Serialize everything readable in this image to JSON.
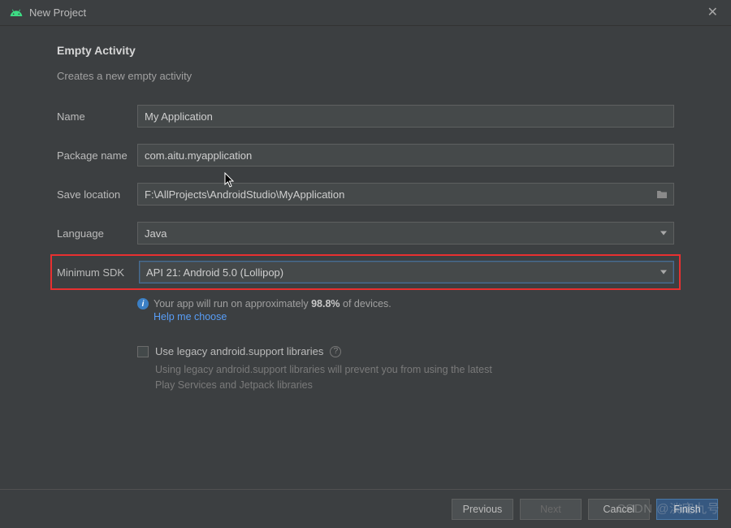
{
  "window": {
    "title": "New Project"
  },
  "heading": "Empty Activity",
  "description": "Creates a new empty activity",
  "fields": {
    "name": {
      "label": "Name",
      "value": "My Application"
    },
    "package": {
      "label": "Package name",
      "value": "com.aitu.myapplication"
    },
    "save_location": {
      "label": "Save location",
      "value": "F:\\AllProjects\\AndroidStudio\\MyApplication"
    },
    "language": {
      "label": "Language",
      "value": "Java"
    },
    "min_sdk": {
      "label": "Minimum SDK",
      "value": "API 21: Android 5.0 (Lollipop)"
    }
  },
  "info": {
    "run_prefix": "Your app will run on approximately ",
    "run_percent": "98.8%",
    "run_suffix": " of devices.",
    "help_link": "Help me choose"
  },
  "legacy": {
    "checkbox_label": "Use legacy android.support libraries",
    "hint": "Using legacy android.support libraries will prevent you from using the latest Play Services and Jetpack libraries"
  },
  "buttons": {
    "previous": "Previous",
    "next": "Next",
    "cancel": "Cancel",
    "finish": "Finish"
  },
  "watermark": "CSDN @淡定九号"
}
